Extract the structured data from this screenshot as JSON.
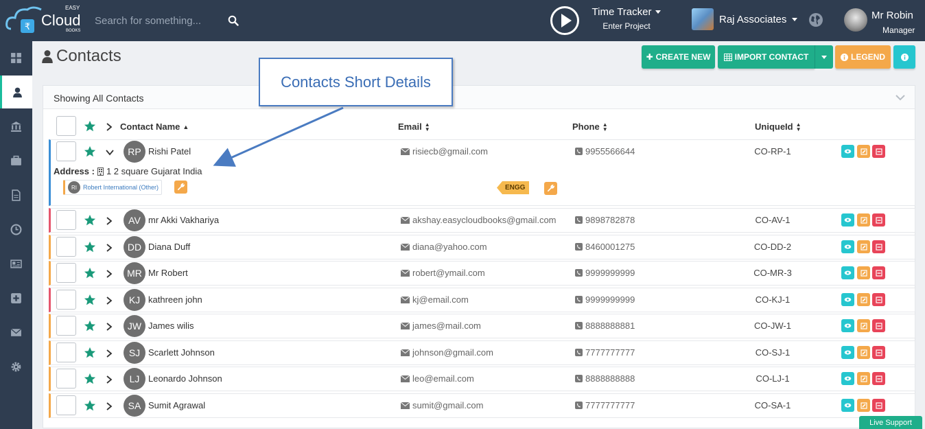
{
  "brand": {
    "easy": "EASY",
    "cloud": "Cloud",
    "books": "BOOKS"
  },
  "search": {
    "placeholder": "Search for something..."
  },
  "time_tracker": {
    "title": "Time Tracker",
    "subtitle": "Enter Project"
  },
  "company": {
    "name": "Raj Associates"
  },
  "user": {
    "name": "Mr Robin",
    "role": "Manager"
  },
  "page": {
    "title": "Contacts"
  },
  "toolbar": {
    "create_new": "CREATE NEW",
    "import_contact": "IMPORT CONTACT",
    "legend": "LEGEND"
  },
  "panel": {
    "title": "Showing All Contacts"
  },
  "columns": {
    "name": "Contact Name",
    "email": "Email",
    "phone": "Phone",
    "uid": "UniqueId"
  },
  "expanded": {
    "address_label": "Address :",
    "address": "1 2 square Gujarat India",
    "org_initials": "RI",
    "org_name": "Robert International (Other)",
    "tag": "ENGG"
  },
  "callout": {
    "text": "Contacts Short Details"
  },
  "live_support": "Live Support",
  "colors": {
    "topbar": "#2f3d50",
    "accent": "#1fae8a",
    "orange": "#f4a84a",
    "teal": "#26c6cf",
    "red": "#e84459"
  },
  "contacts": [
    {
      "initials": "RP",
      "name": "Rishi Patel",
      "email": "risiecb@gmail.com",
      "phone": "9955566644",
      "uid": "CO-RP-1"
    },
    {
      "initials": "AV",
      "name": "mr Akki Vakhariya",
      "email": "akshay.easycloudbooks@gmail.com",
      "phone": "9898782878",
      "uid": "CO-AV-1"
    },
    {
      "initials": "DD",
      "name": "Diana Duff",
      "email": "diana@yahoo.com",
      "phone": "8460001275",
      "uid": "CO-DD-2"
    },
    {
      "initials": "MR",
      "name": "Mr Robert",
      "email": "robert@ymail.com",
      "phone": "9999999999",
      "uid": "CO-MR-3"
    },
    {
      "initials": "KJ",
      "name": "kathreen john",
      "email": "kj@email.com",
      "phone": "9999999999",
      "uid": "CO-KJ-1"
    },
    {
      "initials": "JW",
      "name": "James wilis",
      "email": "james@mail.com",
      "phone": "8888888881",
      "uid": "CO-JW-1"
    },
    {
      "initials": "SJ",
      "name": "Scarlett Johnson",
      "email": "johnson@gmail.com",
      "phone": "7777777777",
      "uid": "CO-SJ-1"
    },
    {
      "initials": "LJ",
      "name": "Leonardo Johnson",
      "email": "leo@email.com",
      "phone": "8888888888",
      "uid": "CO-LJ-1"
    },
    {
      "initials": "SA",
      "name": "Sumit Agrawal",
      "email": "sumit@gmail.com",
      "phone": "7777777777",
      "uid": "CO-SA-1"
    }
  ]
}
